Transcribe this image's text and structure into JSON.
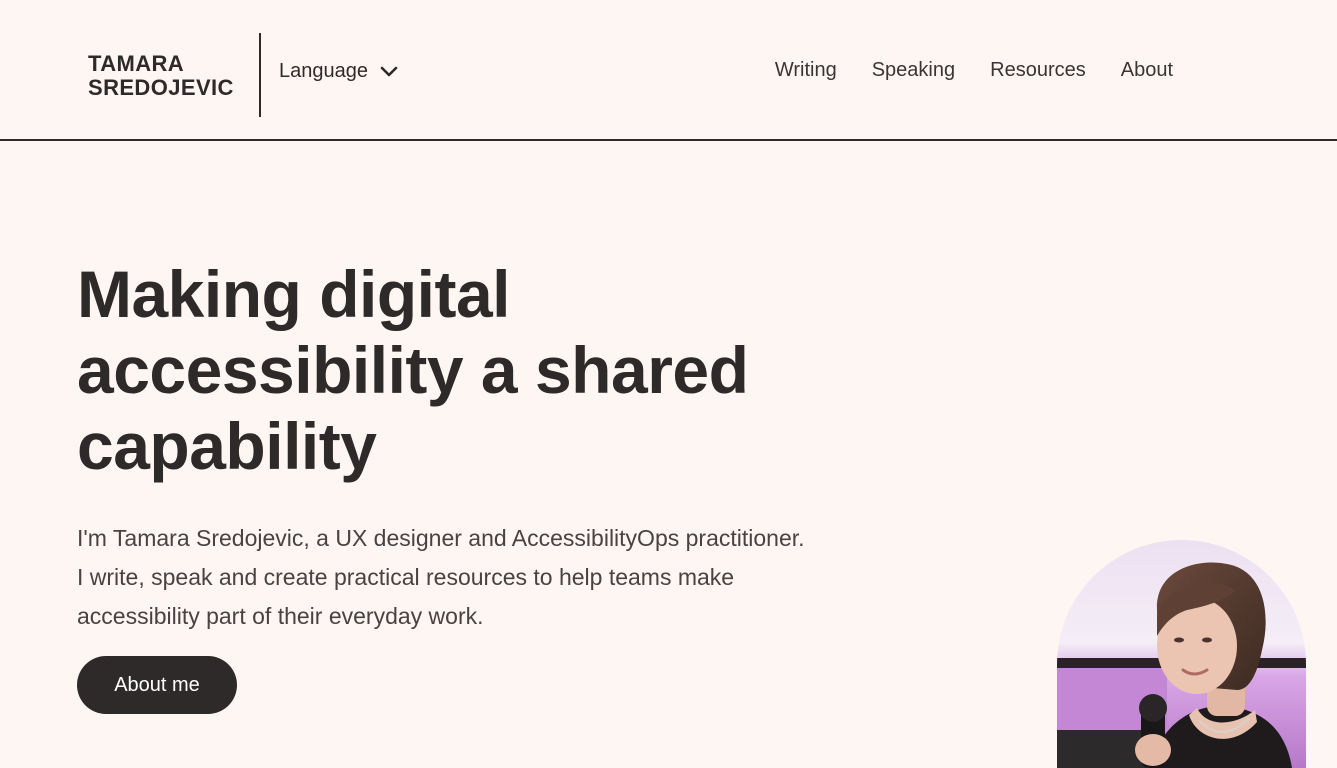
{
  "header": {
    "logo": {
      "line1": "TAMARA",
      "line2": "SREDOJEVIC"
    },
    "language": {
      "label": "Language",
      "icon": "chevron-down-icon"
    },
    "nav": [
      {
        "label": "Writing"
      },
      {
        "label": "Speaking"
      },
      {
        "label": "Resources"
      },
      {
        "label": "About"
      }
    ]
  },
  "hero": {
    "title": "Making digital accessibility a shared capability",
    "intro": "I'm Tamara Sredojevic, a UX designer and AccessibilityOps practitioner. I write, speak and create practical resources to help teams make accessibility part of their everyday work.",
    "cta_label": "About me"
  },
  "colors": {
    "background": "#fdf6f3",
    "text": "#2f2a2a",
    "button_bg": "#2f2a2a",
    "button_text": "#ffffff",
    "photo_accent": "#c98ad8"
  }
}
